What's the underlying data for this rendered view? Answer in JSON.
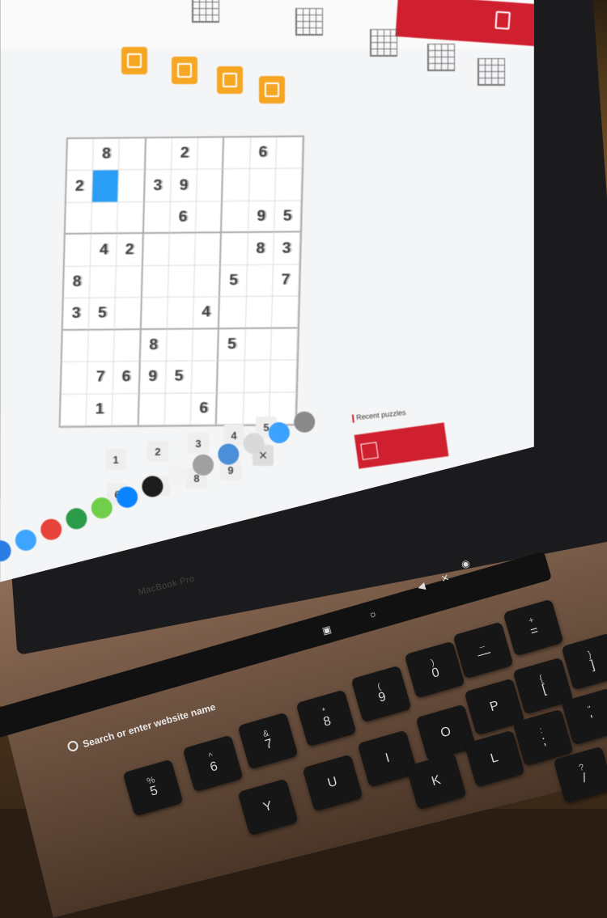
{
  "laptop": {
    "brand": "MacBook Pro"
  },
  "screen": {
    "selected_cell_value": "",
    "board": [
      [
        "",
        "8",
        "",
        "",
        "2",
        "",
        "",
        "6",
        ""
      ],
      [
        "2",
        "",
        "",
        "3",
        "9",
        "",
        "",
        "",
        ""
      ],
      [
        "",
        "",
        "",
        "",
        "6",
        "",
        "",
        "9",
        "5"
      ],
      [
        "",
        "4",
        "2",
        "",
        "",
        "",
        "",
        "8",
        "3"
      ],
      [
        "8",
        "",
        "",
        "",
        "",
        "",
        "5",
        "",
        "7"
      ],
      [
        "3",
        "5",
        "",
        "",
        "",
        "4",
        "",
        "",
        ""
      ],
      [
        "",
        "",
        "",
        "8",
        "",
        "",
        "5",
        "",
        ""
      ],
      [
        "",
        "7",
        "6",
        "9",
        "5",
        "",
        "",
        "",
        ""
      ],
      [
        "",
        "1",
        "",
        "",
        "",
        "6",
        "",
        "",
        ""
      ]
    ],
    "number_pad": [
      "1",
      "2",
      "3",
      "4",
      "5",
      "6",
      "7",
      "8",
      "9"
    ],
    "clear_key": "×",
    "recent_puzzles": {
      "label": "Recent puzzles"
    }
  },
  "keyboard": {
    "touchbar_search": "Search or enter website name",
    "keys": [
      {
        "main": "5",
        "sec": "%"
      },
      {
        "main": "6",
        "sec": "^"
      },
      {
        "main": "7",
        "sec": "&"
      },
      {
        "main": "8",
        "sec": "*"
      },
      {
        "main": "9",
        "sec": "("
      },
      {
        "main": "0",
        "sec": ")"
      },
      {
        "main": "—",
        "sec": "_"
      },
      {
        "main": "=",
        "sec": "+"
      },
      {
        "main": "Y",
        "sec": ""
      },
      {
        "main": "U",
        "sec": ""
      },
      {
        "main": "I",
        "sec": ""
      },
      {
        "main": "O",
        "sec": ""
      },
      {
        "main": "P",
        "sec": ""
      },
      {
        "main": "[",
        "sec": "{"
      },
      {
        "main": "]",
        "sec": "}"
      },
      {
        "main": "K",
        "sec": ""
      },
      {
        "main": "L",
        "sec": ""
      },
      {
        "main": ";",
        "sec": ":"
      },
      {
        "main": "'",
        "sec": "\""
      },
      {
        "main": "/",
        "sec": "?"
      }
    ]
  },
  "colors": {
    "accent_red": "#d0202f",
    "selection_blue": "#2a9df4",
    "tool_orange": "#f5a623"
  }
}
